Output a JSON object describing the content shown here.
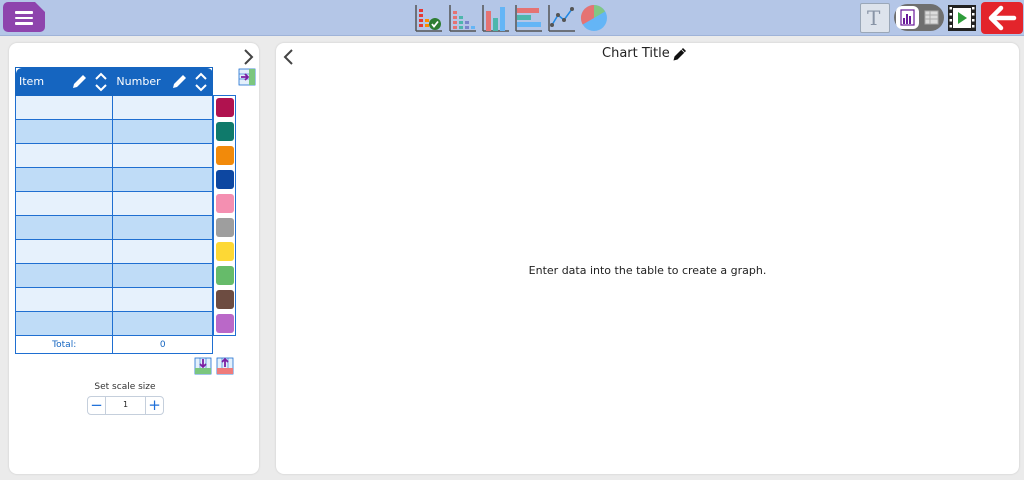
{
  "toolbar": {
    "icons": [
      "menu-icon",
      "chart-check-icon",
      "dot-plot-icon",
      "bar-chart-icon",
      "horizontal-bar-icon",
      "line-graph-icon",
      "pie-chart-icon",
      "text-icon",
      "view-toggle-icon",
      "film-play-icon",
      "back-arrow-icon"
    ],
    "text_button": "T",
    "colors": {
      "bar": "#b4c6e7",
      "menu": "#8e44ad",
      "back": "#e3242b"
    }
  },
  "table": {
    "headers": [
      "Item",
      "Number"
    ],
    "rows": [
      {
        "item": "",
        "number": ""
      },
      {
        "item": "",
        "number": ""
      },
      {
        "item": "",
        "number": ""
      },
      {
        "item": "",
        "number": ""
      },
      {
        "item": "",
        "number": ""
      },
      {
        "item": "",
        "number": ""
      },
      {
        "item": "",
        "number": ""
      },
      {
        "item": "",
        "number": ""
      },
      {
        "item": "",
        "number": ""
      },
      {
        "item": "",
        "number": ""
      }
    ],
    "total_label": "Total:",
    "total_value": "0",
    "swatch_colors": [
      "#b0124f",
      "#0f7a6b",
      "#f28a0a",
      "#0d47a1",
      "#f48fb1",
      "#9e9e9e",
      "#fdd835",
      "#66bb6a",
      "#6d4c41",
      "#ba68c8"
    ]
  },
  "scale": {
    "label": "Set scale size",
    "value": "1",
    "minus": "−",
    "plus": "+"
  },
  "chart": {
    "title": "Chart Title",
    "empty_message": "Enter data into the table to create a graph."
  }
}
